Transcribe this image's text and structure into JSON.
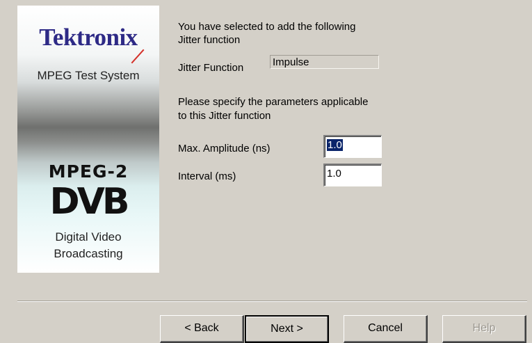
{
  "banner": {
    "brand": "Tektronix",
    "system": "MPEG Test System",
    "mpeg": "MPEG-2",
    "dvb": "DVB",
    "dvb_line1": "Digital Video",
    "dvb_line2": "Broadcasting"
  },
  "content": {
    "intro_line1": "You have selected to add the following",
    "intro_line2": "Jitter function",
    "jitter_function_label": "Jitter Function",
    "jitter_function_value": "Impulse",
    "params_line1": "Please specify the parameters applicable",
    "params_line2": "to this Jitter function",
    "amplitude_label": "Max. Amplitude (ns)",
    "amplitude_value": "1.0",
    "interval_label": "Interval (ms)",
    "interval_value": "1.0"
  },
  "buttons": {
    "back": "< Back",
    "next": "Next >",
    "cancel": "Cancel",
    "help": "Help"
  }
}
